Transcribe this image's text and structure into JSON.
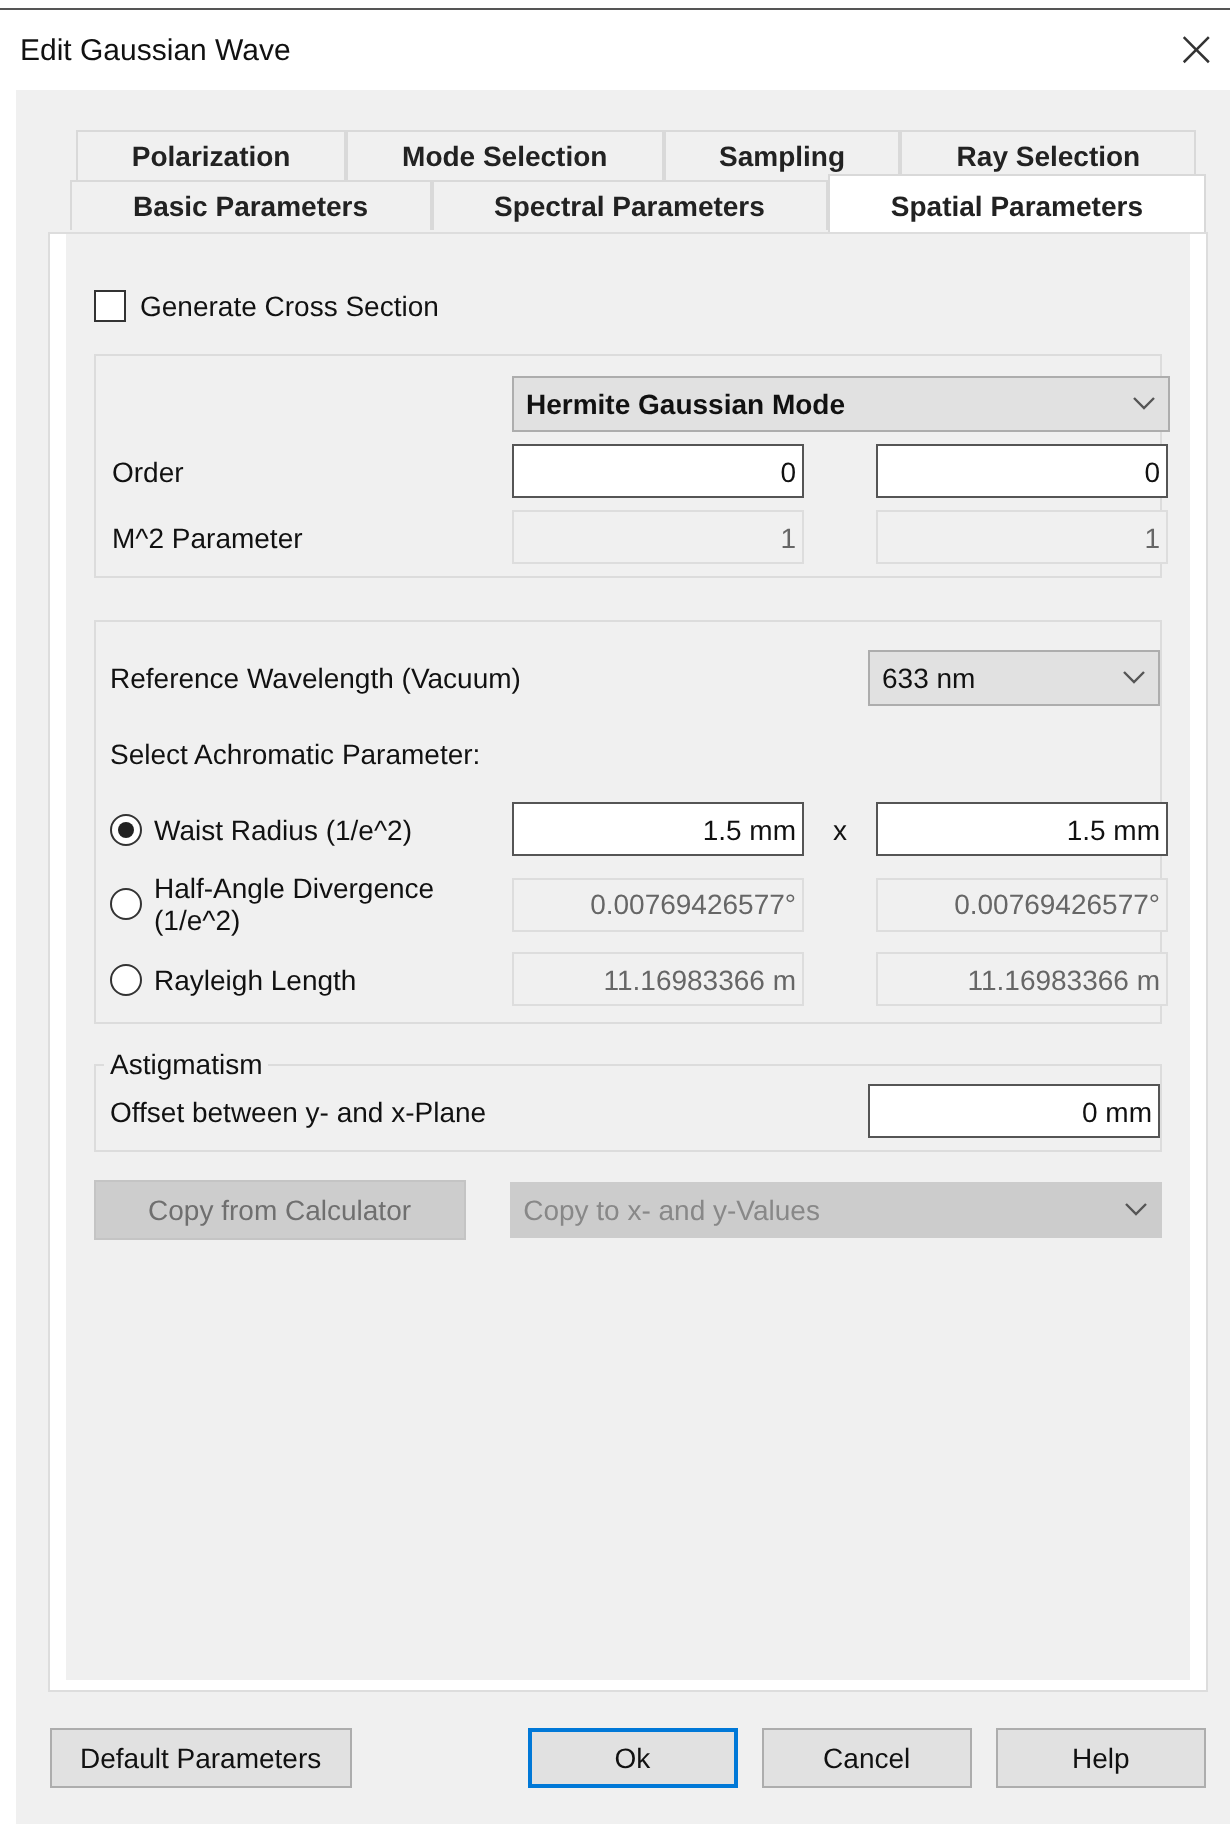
{
  "window": {
    "title": "Edit Gaussian Wave",
    "close": "×"
  },
  "tab_rows": [
    [
      {
        "label": "Polarization",
        "selected": false
      },
      {
        "label": "Mode Selection",
        "selected": false
      },
      {
        "label": "Sampling",
        "selected": false
      },
      {
        "label": "Ray Selection",
        "selected": false
      }
    ],
    [
      {
        "label": "Basic Parameters",
        "selected": false
      },
      {
        "label": "Spectral Parameters",
        "selected": false
      },
      {
        "label": "Spatial Parameters",
        "selected": true
      }
    ]
  ],
  "cross_section": {
    "label": "Generate Cross Section",
    "checked": false
  },
  "mode_group": {
    "mode": "Hermite Gaussian Mode",
    "rows": [
      {
        "label": "Order",
        "fields": [
          {
            "value": "0",
            "disabled": false
          },
          {
            "value": "0",
            "disabled": false
          }
        ]
      },
      {
        "label": "M^2 Parameter",
        "fields": [
          {
            "value": "1",
            "disabled": true
          },
          {
            "value": "1",
            "disabled": true
          }
        ]
      }
    ]
  },
  "wavelength_group": {
    "label": "Reference Wavelength (Vacuum)",
    "wavelength": "633 nm",
    "select_label": "Select Achromatic Parameter:",
    "params": [
      {
        "label": "Waist Radius (1/e^2)",
        "selected": true,
        "separator": "x",
        "fields": [
          {
            "value": "1.5 mm",
            "disabled": false
          },
          {
            "value": "1.5 mm",
            "disabled": false
          }
        ]
      },
      {
        "label": "Half-Angle Divergence (1/e^2)",
        "selected": false,
        "fields": [
          {
            "value": "0.00769426577°",
            "disabled": true
          },
          {
            "value": "0.00769426577°",
            "disabled": true
          }
        ]
      },
      {
        "label": "Rayleigh Length",
        "selected": false,
        "fields": [
          {
            "value": "11.16983366 m",
            "disabled": true
          },
          {
            "value": "11.16983366 m",
            "disabled": true
          }
        ]
      }
    ]
  },
  "astigmatism": {
    "title": "Astigmatism",
    "label": "Offset between y- and x-Plane",
    "field": {
      "value": "0 mm",
      "disabled": false
    }
  },
  "copy_button": {
    "label": "Copy from Calculator",
    "disabled": true
  },
  "copy_target": {
    "value": "Copy to x- and y-Values",
    "disabled": true
  },
  "buttons": [
    {
      "label": "Default Parameters",
      "kind": "left",
      "default": false
    },
    {
      "label": "Ok",
      "kind": "right",
      "default": true
    },
    {
      "label": "Cancel",
      "kind": "right",
      "default": false
    },
    {
      "label": "Help",
      "kind": "right",
      "default": false
    }
  ]
}
